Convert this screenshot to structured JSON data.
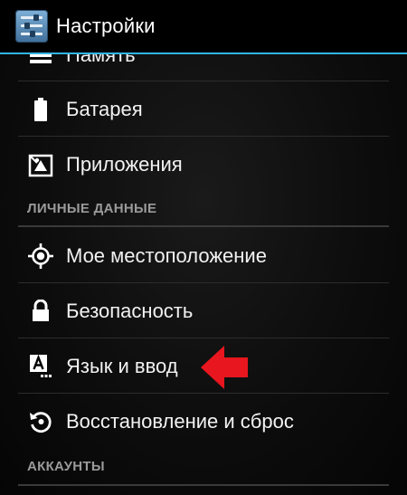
{
  "action_bar": {
    "title": "Настройки",
    "icon": "settings-app-icon"
  },
  "items_top": [
    {
      "label": "Память",
      "icon": "storage-icon"
    },
    {
      "label": "Батарея",
      "icon": "battery-icon"
    },
    {
      "label": "Приложения",
      "icon": "apps-icon"
    }
  ],
  "section_personal": "ЛИЧНЫЕ ДАННЫЕ",
  "items_personal": [
    {
      "label": "Мое местоположение",
      "icon": "location-icon"
    },
    {
      "label": "Безопасность",
      "icon": "lock-icon"
    },
    {
      "label": "Язык и ввод",
      "icon": "language-input-icon"
    },
    {
      "label": "Восстановление и сброс",
      "icon": "backup-reset-icon"
    }
  ],
  "section_accounts": "АККАУНТЫ",
  "colors": {
    "accent": "#33b5e5",
    "annotation_arrow": "#e8161e"
  }
}
